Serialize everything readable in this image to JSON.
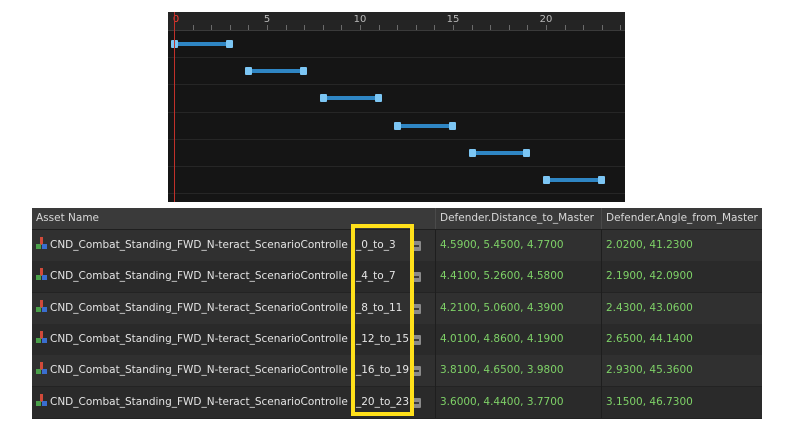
{
  "timeline": {
    "ruler_ticks": [
      "0",
      "5",
      "10",
      "15",
      "20"
    ],
    "clips": [
      {
        "start": 0,
        "end": 3
      },
      {
        "start": 4,
        "end": 7
      },
      {
        "start": 8,
        "end": 11
      },
      {
        "start": 12,
        "end": 15
      },
      {
        "start": 16,
        "end": 19
      },
      {
        "start": 20,
        "end": 23
      }
    ]
  },
  "table": {
    "headers": {
      "asset_name": "Asset Name",
      "distance": "Defender.Distance_to_Master",
      "angle": "Defender.Angle_from_Master"
    },
    "rows": [
      {
        "base": "CND_Combat_Standing_FWD_N-teract_ScenarioControlle",
        "suffix": "_0_to_3",
        "distance": "4.5900, 5.4500, 4.7700",
        "angle": "2.0200, 41.2300"
      },
      {
        "base": "CND_Combat_Standing_FWD_N-teract_ScenarioControlle",
        "suffix": "_4_to_7",
        "distance": "4.4100, 5.2600, 4.5800",
        "angle": "2.1900, 42.0900"
      },
      {
        "base": "CND_Combat_Standing_FWD_N-teract_ScenarioControlle",
        "suffix": "_8_to_11",
        "distance": "4.2100, 5.0600, 4.3900",
        "angle": "2.4300, 43.0600"
      },
      {
        "base": "CND_Combat_Standing_FWD_N-teract_ScenarioControlle",
        "suffix": "_12_to_15",
        "distance": "4.0100, 4.8600, 4.1900",
        "angle": "2.6500, 44.1400"
      },
      {
        "base": "CND_Combat_Standing_FWD_N-teract_ScenarioControlle",
        "suffix": "_16_to_19",
        "distance": "3.8100, 4.6500, 3.9800",
        "angle": "2.9300, 45.3600"
      },
      {
        "base": "CND_Combat_Standing_FWD_N-teract_ScenarioControlle",
        "suffix": "_20_to_23",
        "distance": "3.6000, 4.4400, 3.7700",
        "angle": "3.1500, 46.7300"
      }
    ]
  },
  "colors": {
    "highlight": "#ffe01a",
    "value_text": "#7ed167",
    "clip": "#2f86c4",
    "playhead": "#c0302a"
  },
  "icons": [
    "asset-icon",
    "browse-icon"
  ]
}
